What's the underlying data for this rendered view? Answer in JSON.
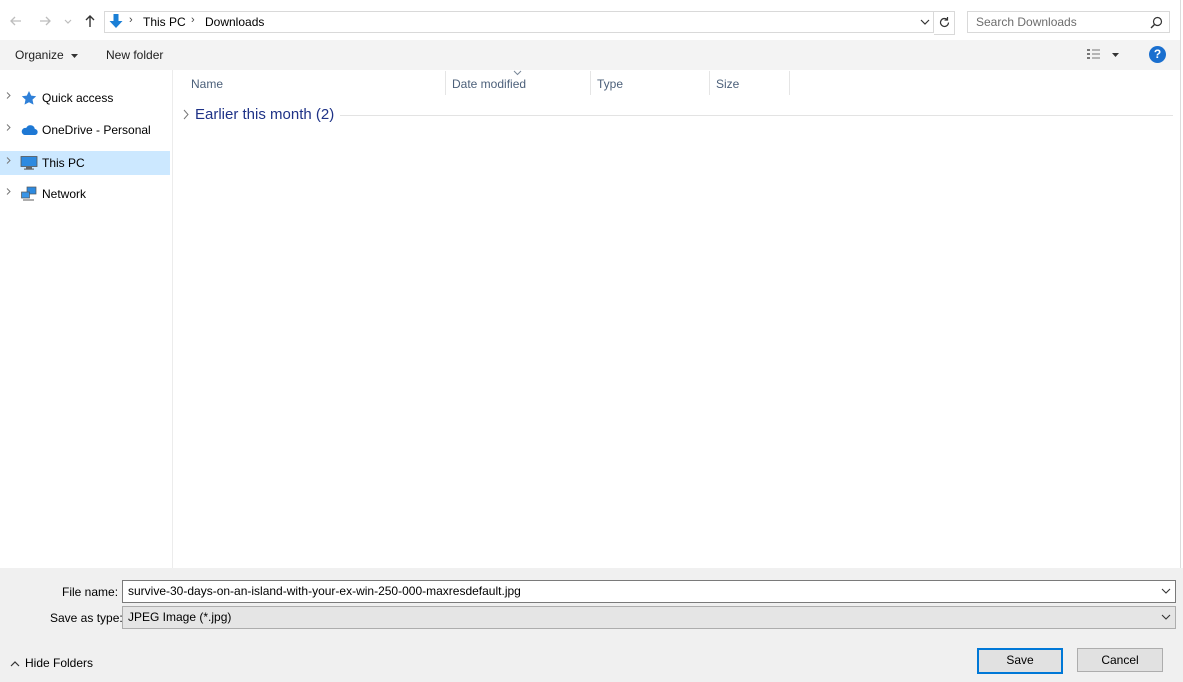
{
  "address_bar": {
    "crumbs": [
      "This PC",
      "Downloads"
    ]
  },
  "search": {
    "placeholder": "Search Downloads"
  },
  "toolbar": {
    "organize_label": "Organize",
    "new_folder_label": "New folder",
    "help_label": "?"
  },
  "sidebar": {
    "items": [
      {
        "label": "Quick access",
        "icon": "star-icon",
        "selected": false
      },
      {
        "label": "OneDrive - Personal",
        "icon": "cloud-icon",
        "selected": false
      },
      {
        "label": "This PC",
        "icon": "computer-icon",
        "selected": true
      },
      {
        "label": "Network",
        "icon": "network-icon",
        "selected": false
      }
    ]
  },
  "file_list": {
    "columns": [
      "Name",
      "Date modified",
      "Type",
      "Size"
    ],
    "sorted_column": "Date modified",
    "groups": [
      {
        "title": "Earlier this month (2)",
        "expanded": false
      }
    ]
  },
  "save_panel": {
    "file_name_label": "File name:",
    "file_name_value": "survive-30-days-on-an-island-with-your-ex-win-250-000-maxresdefault.jpg",
    "save_as_type_label": "Save as type:",
    "save_as_type_value": "JPEG Image (*.jpg)",
    "hide_folders_label": "Hide Folders",
    "save_label": "Save",
    "cancel_label": "Cancel"
  },
  "colors": {
    "accent": "#0078d7",
    "selection": "#cce8ff",
    "group_title": "#1e3287"
  }
}
